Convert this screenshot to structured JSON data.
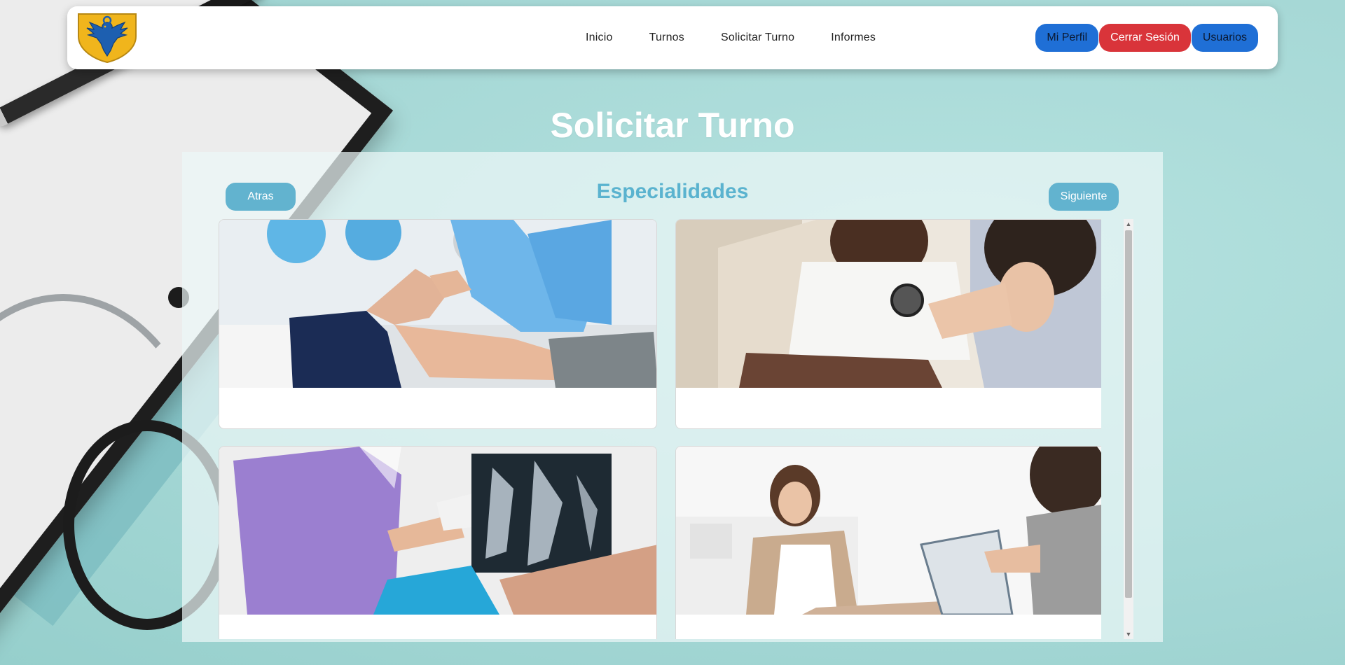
{
  "nav": {
    "links": [
      "Inicio",
      "Turnos",
      "Solicitar Turno",
      "Informes"
    ],
    "actions": {
      "profile": "Mi Perfil",
      "logout": "Cerrar Sesión",
      "users": "Usuarios"
    }
  },
  "page": {
    "title": "Solicitar Turno"
  },
  "panel": {
    "back_label": "Atras",
    "heading": "Especialidades",
    "next_label": "Siguiente"
  },
  "cards": [
    {
      "image": "physiotherapy-knee-photo"
    },
    {
      "image": "pediatrics-stethoscope-photo"
    },
    {
      "image": "traumatology-xray-photo"
    },
    {
      "image": "psychology-consultation-photo"
    }
  ],
  "colors": {
    "accent": "#5ab3cf",
    "primary_button": "#1f6fd6",
    "danger_button": "#d9343a",
    "background": "#a9dcda"
  }
}
